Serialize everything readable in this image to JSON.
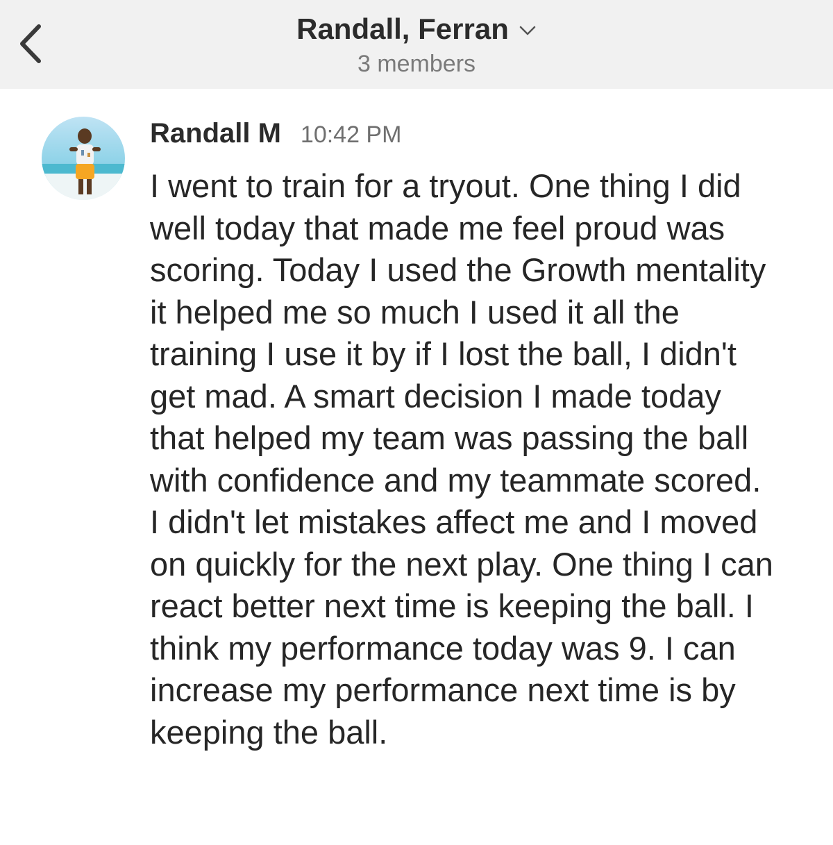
{
  "header": {
    "title": "Randall, Ferran",
    "subtitle": "3 members",
    "back_icon": "chevron-left-icon",
    "dropdown_icon": "chevron-down-icon"
  },
  "message": {
    "sender": "Randall M",
    "time": "10:42 PM",
    "avatar_icon": "user-avatar-photo",
    "text": "I went to train for a tryout. One thing I did well today that made me feel proud was scoring. Today I used the Growth mentality it helped me so much I used it all the training I use it by if I lost the ball, I didn't get mad. A smart decision I made today that helped my team was passing the ball with confidence and my teammate scored. I didn't let mistakes affect me and I moved on quickly for the next play. One thing I can react better next time is keeping the ball. I think my performance today was 9. I can increase my performance next time is by keeping the ball."
  },
  "colors": {
    "header_bg": "#f1f1f1",
    "title_text": "#2b2b2b",
    "muted_text": "#7a7a7a",
    "body_text": "#262626"
  }
}
